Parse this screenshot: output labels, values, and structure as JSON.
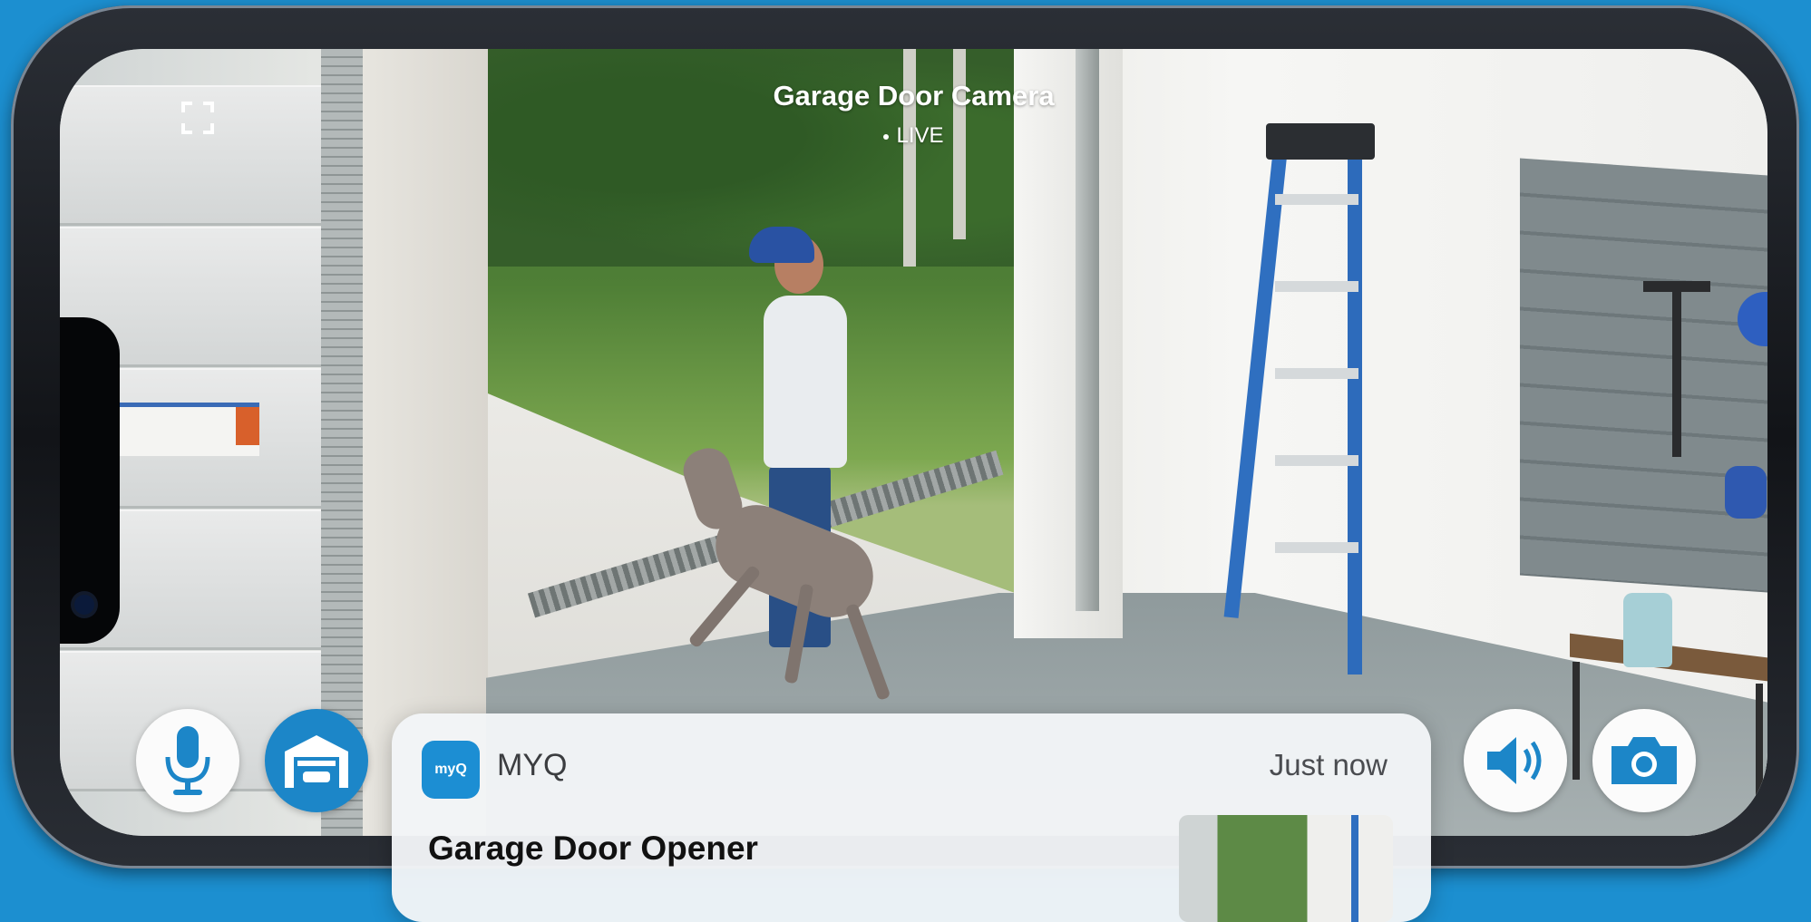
{
  "camera": {
    "title": "Garage Door Camera",
    "status": "LIVE"
  },
  "controls": {
    "left": [
      {
        "name": "microphone",
        "icon": "microphone-icon"
      },
      {
        "name": "garage-door",
        "icon": "garage-icon"
      }
    ],
    "right": [
      {
        "name": "speaker",
        "icon": "speaker-icon"
      },
      {
        "name": "snapshot",
        "icon": "camera-icon"
      }
    ]
  },
  "notification": {
    "app_logo_text": "myQ",
    "app_name": "MYQ",
    "time": "Just now",
    "title": "Garage Door Opener"
  },
  "colors": {
    "background": "#1c8fd0",
    "accent": "#1c86c8",
    "notification_bg": "#f3f5f7"
  }
}
